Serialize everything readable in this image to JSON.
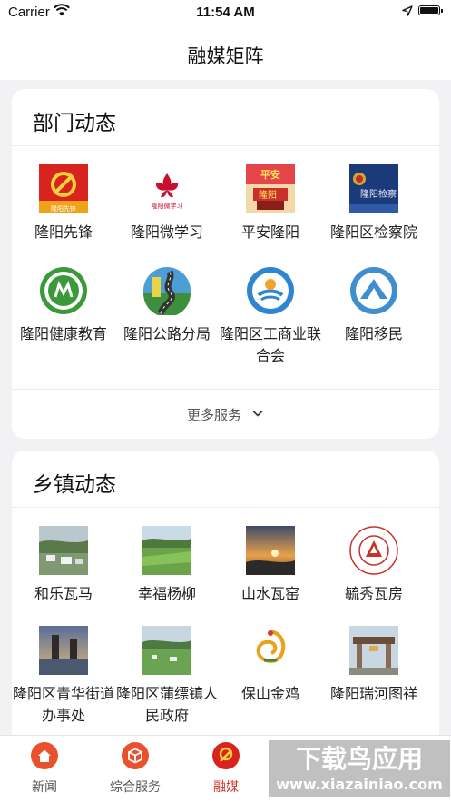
{
  "status_bar": {
    "carrier": "Carrier",
    "time": "11:54 AM"
  },
  "nav": {
    "title": "融媒矩阵"
  },
  "departments": {
    "title": "部门动态",
    "items": [
      {
        "label": "隆阳先锋",
        "icon": "party-emblem-icon"
      },
      {
        "label": "隆阳微学习",
        "icon": "bauhinia-logo-icon"
      },
      {
        "label": "平安隆阳",
        "icon": "tiananmen-badge-icon"
      },
      {
        "label": "隆阳区检察院",
        "icon": "procuratorate-emblem-icon"
      },
      {
        "label": "隆阳健康教育",
        "icon": "health-wreath-icon"
      },
      {
        "label": "隆阳公路分局",
        "icon": "road-logo-icon"
      },
      {
        "label": "隆阳区工商业联合会",
        "icon": "federation-logo-icon"
      },
      {
        "label": "隆阳移民",
        "icon": "migration-logo-icon"
      }
    ],
    "more_label": "更多服务"
  },
  "towns": {
    "title": "乡镇动态",
    "items": [
      {
        "label": "和乐瓦马",
        "icon": "village-photo-icon"
      },
      {
        "label": "幸福杨柳",
        "icon": "field-photo-icon"
      },
      {
        "label": "山水瓦窑",
        "icon": "sunset-photo-icon"
      },
      {
        "label": "毓秀瓦房",
        "icon": "party-badge-icon"
      },
      {
        "label": "隆阳区青华街道办事处",
        "icon": "pagoda-photo-icon"
      },
      {
        "label": "隆阳区蒲缥镇人民政府",
        "icon": "valley-photo-icon"
      },
      {
        "label": "保山金鸡",
        "icon": "golden-rooster-icon"
      },
      {
        "label": "隆阳瑞河图祥",
        "icon": "gate-photo-icon"
      }
    ]
  },
  "tabs": [
    {
      "label": "新闻",
      "icon": "home-icon"
    },
    {
      "label": "综合服务",
      "icon": "box-icon"
    },
    {
      "label": "融媒",
      "icon": "party-emblem-icon",
      "active": true
    }
  ],
  "watermark": {
    "line1": "下载鸟应用",
    "line2": "www.xiazainiao.com"
  },
  "colors": {
    "accent": "#d0342c",
    "tab_icon_bg": "#e8502e"
  }
}
